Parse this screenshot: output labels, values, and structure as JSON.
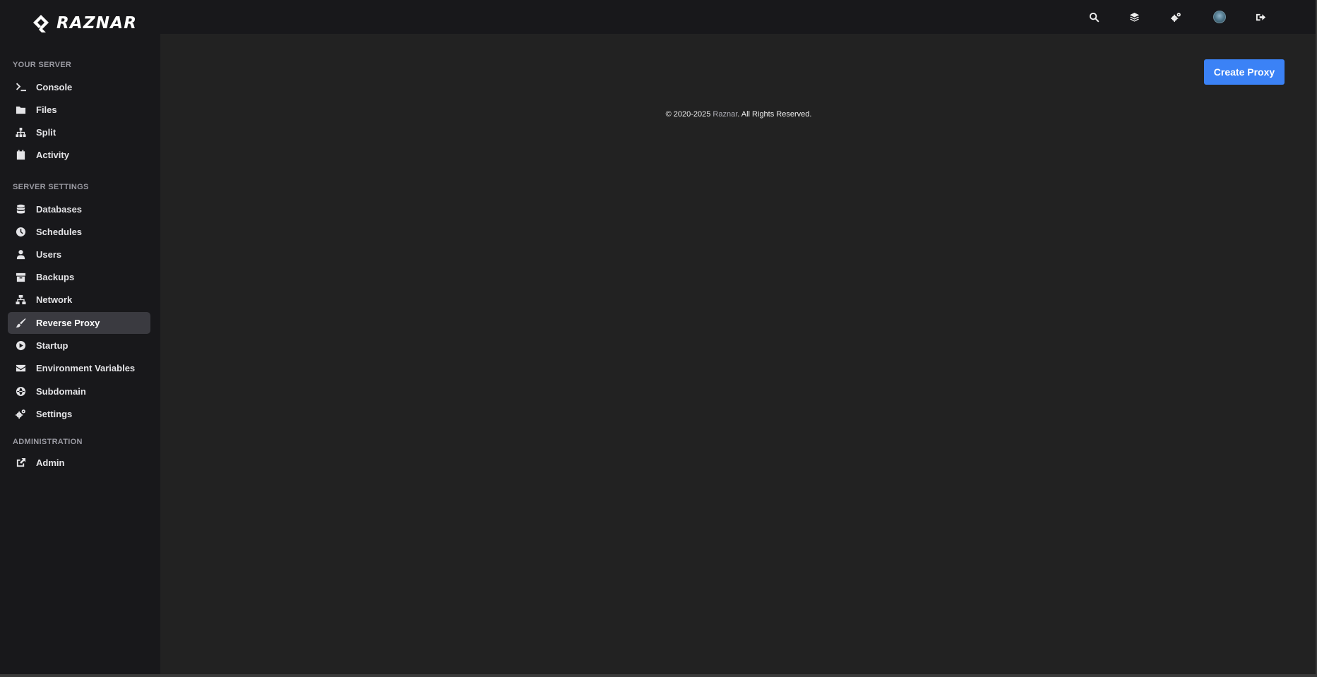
{
  "brand": {
    "name": "RAZNAR"
  },
  "sidebar": {
    "sections": [
      {
        "title": "YOUR SERVER"
      },
      {
        "title": "SERVER SETTINGS"
      },
      {
        "title": "ADMINISTRATION"
      }
    ],
    "items": [
      {
        "label": "Console",
        "icon": "terminal-icon"
      },
      {
        "label": "Files",
        "icon": "folder-icon"
      },
      {
        "label": "Split",
        "icon": "sitemap-icon"
      },
      {
        "label": "Activity",
        "icon": "calendar-icon"
      },
      {
        "label": "Databases",
        "icon": "database-icon"
      },
      {
        "label": "Schedules",
        "icon": "clock-icon"
      },
      {
        "label": "Users",
        "icon": "user-icon"
      },
      {
        "label": "Backups",
        "icon": "archive-icon"
      },
      {
        "label": "Network",
        "icon": "network-icon"
      },
      {
        "label": "Reverse Proxy",
        "icon": "brush-icon",
        "active": true
      },
      {
        "label": "Startup",
        "icon": "play-circle-icon"
      },
      {
        "label": "Environment Variables",
        "icon": "envelope-icon"
      },
      {
        "label": "Subdomain",
        "icon": "globe-icon"
      },
      {
        "label": "Settings",
        "icon": "cogs-icon"
      },
      {
        "label": "Admin",
        "icon": "external-link-icon"
      }
    ]
  },
  "topbar": {
    "icons": [
      "search-icon",
      "layers-icon",
      "cogs-icon",
      "avatar",
      "sign-out-icon"
    ]
  },
  "main": {
    "create_button": "Create Proxy"
  },
  "footer": {
    "prefix": "© 2020-2025 ",
    "brand_link": "Raznar",
    "suffix": ".  All Rights Reserved."
  },
  "colors": {
    "accent": "#3b82f6",
    "sidebar_bg": "#18181b",
    "content_bg": "#222222",
    "active_item_bg": "#3a3a40"
  }
}
